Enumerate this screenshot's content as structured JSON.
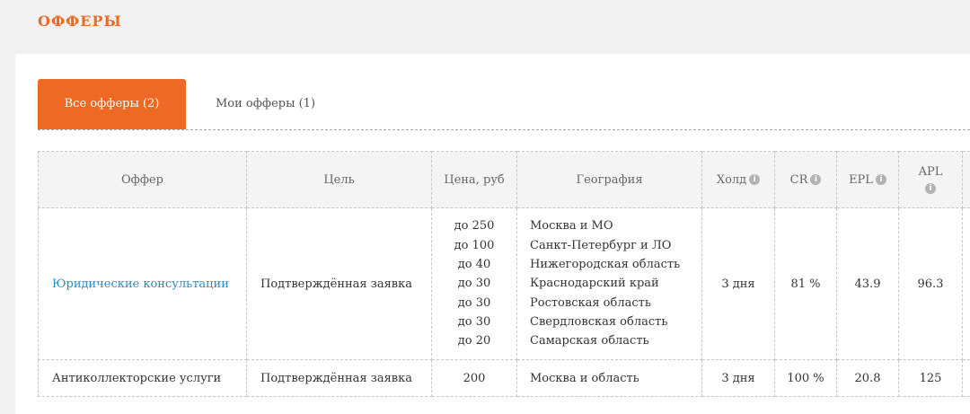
{
  "page": {
    "title": "ОФФЕРЫ"
  },
  "tabs": [
    {
      "label": "Все офферы (2)",
      "active": true
    },
    {
      "label": "Мои офферы (1)",
      "active": false
    }
  ],
  "table": {
    "headers": {
      "offer": "Оффер",
      "goal": "Цель",
      "price": "Цена, руб",
      "geo": "География",
      "hold": "Холд",
      "cr": "CR",
      "epl": "EPL",
      "apl": "APL"
    },
    "info_icon": "i",
    "rows": [
      {
        "offer": "Юридические консультации",
        "goal": "Подтверждённая заявка",
        "prices": [
          "до 250",
          "до 100",
          "до 40",
          "до 30",
          "до 30",
          "до 30",
          "до 20"
        ],
        "geos": [
          "Москва и МО",
          "Санкт-Петербург и ЛО",
          "Нижегородская область",
          "Краснодарский край",
          "Ростовская область",
          "Свердловская область",
          "Самарская область"
        ],
        "hold": "3 дня",
        "cr": "81 %",
        "epl": "43.9",
        "apl": "96.3"
      },
      {
        "offer": "Антиколлекторские услуги",
        "goal": "Подтверждённая заявка",
        "prices": [
          "200"
        ],
        "geos": [
          "Москва и область"
        ],
        "hold": "3 дня",
        "cr": "100 %",
        "epl": "20.8",
        "apl": "125"
      }
    ]
  },
  "colors": {
    "accent": "#ee6a24",
    "link": "#2a8bc5",
    "background": "#f1f1f1"
  }
}
